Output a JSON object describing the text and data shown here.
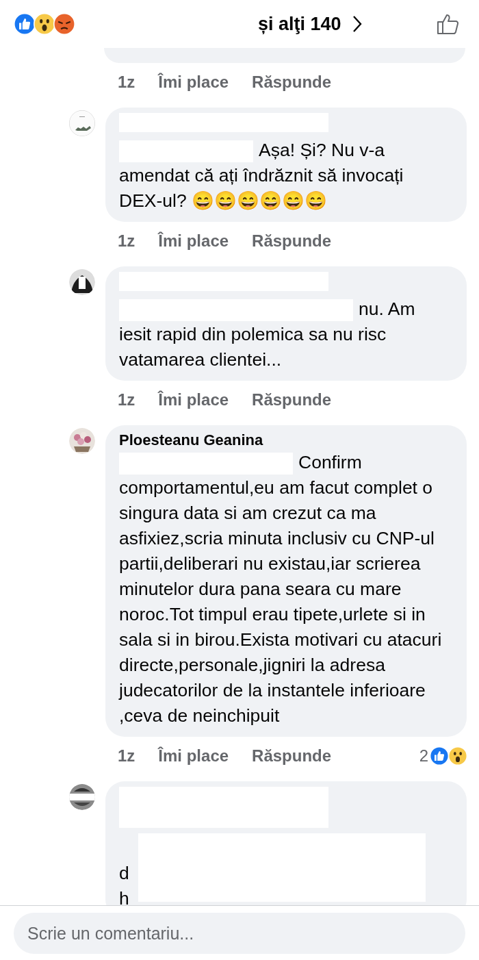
{
  "header": {
    "summary": "și alţi 140"
  },
  "comments": [
    {
      "kind": "tail",
      "time": "1z",
      "like": "Îmi place",
      "reply": "Răspunde"
    },
    {
      "kind": "full",
      "text": "Așa! Și? Nu v-a amendat că ați îndrăznit să invocați DEX-ul? 😄😄😄😄😄😄",
      "time": "1z",
      "like": "Îmi place",
      "reply": "Răspunde"
    },
    {
      "kind": "full",
      "text": "nu. Am iesit rapid din polemica sa nu risc vatamarea clientei...",
      "time": "1z",
      "like": "Îmi place",
      "reply": "Răspunde"
    },
    {
      "kind": "full",
      "author": "Ploesteanu Geanina",
      "text": "Confirm comportamentul,eu am facut complet o singura data si am crezut ca ma asfixiez,scria minuta inclusiv cu CNP-ul partii,deliberari nu existau,iar scrierea minutelor dura pana seara cu mare noroc.Tot timpul erau tipete,urlete si in sala si in birou.Exista motivari cu atacuri directe,personale,jigniri la adresa judecatorilor de la instantele inferioare ,ceva de neinchipuit",
      "time": "1z",
      "like": "Îmi place",
      "reply": "Răspunde",
      "reaction_count": "2"
    },
    {
      "kind": "cut",
      "lines": [
        "d",
        "h"
      ]
    }
  ],
  "composer": {
    "placeholder": "Scrie un comentariu..."
  }
}
